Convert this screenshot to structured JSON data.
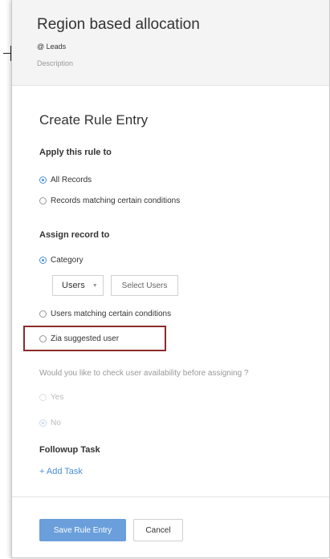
{
  "header": {
    "title": "Region based allocation",
    "module": "@ Leads",
    "description": "Description"
  },
  "form": {
    "heading": "Create Rule Entry",
    "apply": {
      "label": "Apply this rule to",
      "options": [
        "All Records",
        "Records matching certain conditions"
      ],
      "selected": "All Records"
    },
    "assign": {
      "label": "Assign record to",
      "options": [
        "Category",
        "Users matching certain conditions",
        "Zia suggested user"
      ],
      "selected": "Category",
      "category_value": "Users",
      "select_users_label": "Select Users"
    },
    "availability": {
      "question": "Would you like to check user availability before assigning ?",
      "options": [
        "Yes",
        "No"
      ],
      "selected": "No"
    },
    "followup": {
      "label": "Followup Task",
      "add_task": "+ Add Task"
    }
  },
  "footer": {
    "save_label": "Save Rule Entry",
    "cancel_label": "Cancel"
  },
  "colors": {
    "accent": "#4a90e2",
    "primary_button": "#6a9fdb",
    "highlight_border": "#8b2c2c"
  }
}
